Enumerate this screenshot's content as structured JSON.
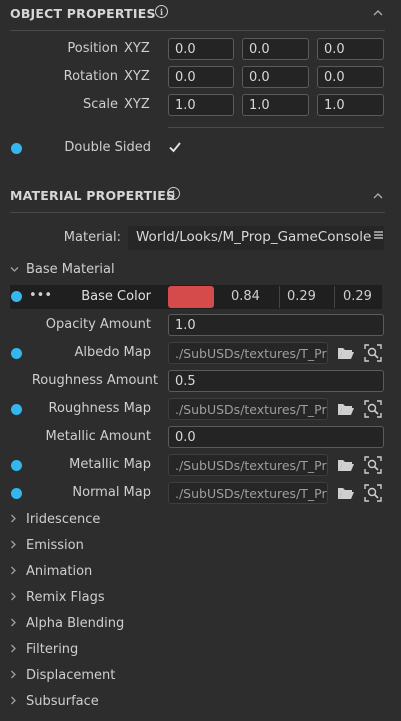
{
  "object_properties": {
    "title": "OBJECT PROPERTIES",
    "position": {
      "label": "Position",
      "axes": "XYZ",
      "values": [
        "0.0",
        "0.0",
        "0.0"
      ]
    },
    "rotation": {
      "label": "Rotation",
      "axes": "XYZ",
      "values": [
        "0.0",
        "0.0",
        "0.0"
      ]
    },
    "scale": {
      "label": "Scale",
      "axes": "XYZ",
      "values": [
        "1.0",
        "1.0",
        "1.0"
      ]
    },
    "double_sided": {
      "label": "Double Sided",
      "checked": true
    }
  },
  "material_properties": {
    "title": "MATERIAL PROPERTIES",
    "material": {
      "label": "Material:",
      "value": "World/Looks/M_Prop_GameConsole"
    },
    "base_material": {
      "title": "Base Material",
      "base_color": {
        "label": "Base Color",
        "r": "0.84",
        "g": "0.29",
        "b": "0.29",
        "swatch": "#d54a4a"
      },
      "opacity": {
        "label": "Opacity Amount",
        "value": "1.0"
      },
      "albedo_map": {
        "label": "Albedo Map",
        "value": "./SubUSDs/textures/T_Pr"
      },
      "roughness_amount": {
        "label": "Roughness Amount",
        "value": "0.5"
      },
      "roughness_map": {
        "label": "Roughness Map",
        "value": "./SubUSDs/textures/T_Pr"
      },
      "metallic_amount": {
        "label": "Metallic Amount",
        "value": "0.0"
      },
      "metallic_map": {
        "label": "Metallic Map",
        "value": "./SubUSDs/textures/T_Pr"
      },
      "normal_map": {
        "label": "Normal Map",
        "value": "./SubUSDs/textures/T_Pr"
      }
    },
    "groups": [
      "Iridescence",
      "Emission",
      "Animation",
      "Remix Flags",
      "Alpha Blending",
      "Filtering",
      "Displacement",
      "Subsurface"
    ]
  },
  "colors": {
    "accent_dot": "#35b6ef",
    "background": "#2d2d2d"
  },
  "icons": {
    "info": "info-icon",
    "collapse": "chevron-up-icon",
    "folder": "folder-icon",
    "browse": "search-icon",
    "menu": "hamburger-icon",
    "options": "ellipsis-icon"
  }
}
